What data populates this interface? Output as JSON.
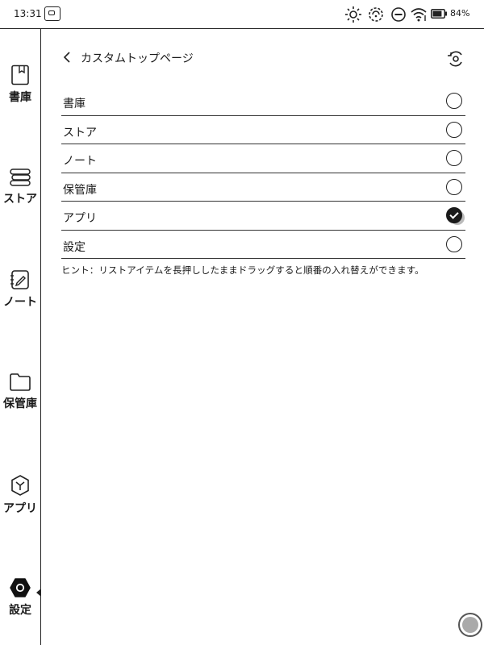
{
  "status_bar": {
    "time": "13:31",
    "battery_percent": "84%",
    "battery_level": 0.84
  },
  "sidebar": {
    "items": [
      {
        "label": "書庫",
        "icon": "bookmark-book-icon",
        "active": false
      },
      {
        "label": "ストア",
        "icon": "books-stack-icon",
        "active": false
      },
      {
        "label": "ノート",
        "icon": "note-pen-icon",
        "active": false
      },
      {
        "label": "保管庫",
        "icon": "folder-icon",
        "active": false
      },
      {
        "label": "アプリ",
        "icon": "apps-cube-icon",
        "active": false
      },
      {
        "label": "設定",
        "icon": "settings-hexagon-icon",
        "active": true
      }
    ]
  },
  "header": {
    "title": "カスタムトップページ"
  },
  "list": {
    "items": [
      {
        "label": "書庫",
        "checked": false
      },
      {
        "label": "ストア",
        "checked": false
      },
      {
        "label": "ノート",
        "checked": false
      },
      {
        "label": "保管庫",
        "checked": false
      },
      {
        "label": "アプリ",
        "checked": true
      },
      {
        "label": "設定",
        "checked": false
      }
    ]
  },
  "hint": "ヒント：リストアイテムを長押ししたままドラッグすると順番の入れ替えができます。",
  "colors": {
    "foreground": "#1a1a1a",
    "background": "#ffffff"
  }
}
